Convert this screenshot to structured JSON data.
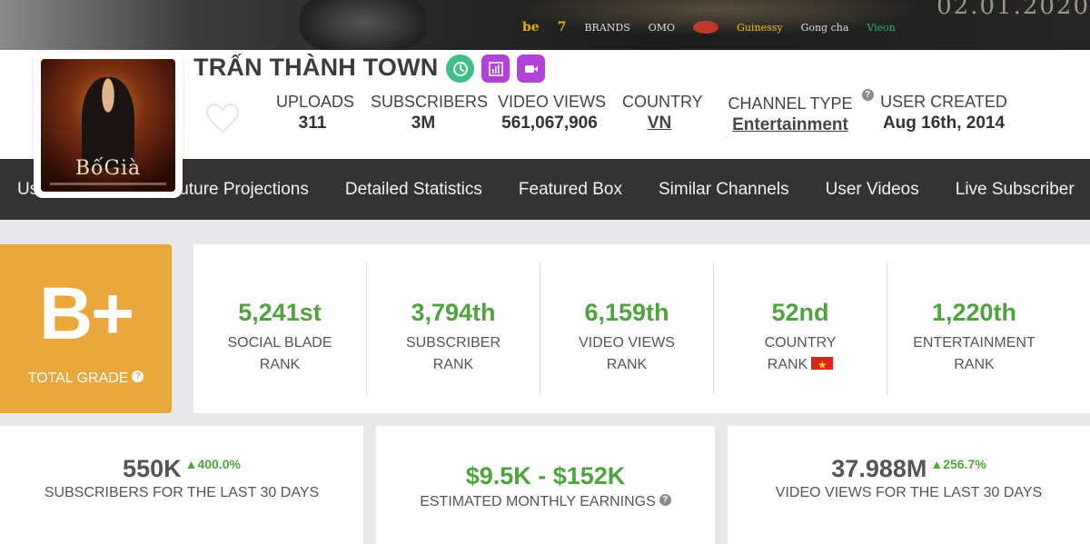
{
  "banner": {
    "sponsors": [
      "be",
      "7",
      "BRANDS",
      "OMO",
      "",
      "Guinessy",
      "Gong cha",
      "Vieon"
    ],
    "date_text": "02.01.2020"
  },
  "channel": {
    "name": "TRẤN THÀNH TOWN",
    "avatar_title": "BốGià"
  },
  "stats": [
    {
      "label": "UPLOADS",
      "value": "311"
    },
    {
      "label": "SUBSCRIBERS",
      "value": "3M"
    },
    {
      "label": "VIDEO VIEWS",
      "value": "561,067,906"
    },
    {
      "label": "COUNTRY",
      "value": "VN"
    },
    {
      "label": "CHANNEL TYPE",
      "value": "Entertainment"
    },
    {
      "label": "USER CREATED",
      "value": "Aug 16th, 2014"
    }
  ],
  "nav": [
    "User Summary",
    "Future Projections",
    "Detailed Statistics",
    "Featured Box",
    "Similar Channels",
    "User Videos",
    "Live Subscriber"
  ],
  "grade": {
    "letter": "B+",
    "label": "TOTAL GRADE",
    "color": "#eaa73b"
  },
  "ranks": [
    {
      "value": "5,241st",
      "line1": "SOCIAL BLADE",
      "line2": "RANK"
    },
    {
      "value": "3,794th",
      "line1": "SUBSCRIBER",
      "line2": "RANK"
    },
    {
      "value": "6,159th",
      "line1": "VIDEO VIEWS",
      "line2": "RANK"
    },
    {
      "value": "52nd",
      "line1": "COUNTRY",
      "line2": "RANK"
    },
    {
      "value": "1,220th",
      "line1": "ENTERTAINMENT",
      "line2": "RANK"
    }
  ],
  "cards": {
    "subs": {
      "value": "550K",
      "delta": "400.0%",
      "caption": "SUBSCRIBERS FOR THE LAST 30 DAYS"
    },
    "earnings": {
      "value": "$9.5K - $152K",
      "caption": "ESTIMATED MONTHLY EARNINGS"
    },
    "views": {
      "value": "37.988M",
      "delta": "256.7%",
      "caption": "VIDEO VIEWS FOR THE LAST 30 DAYS"
    }
  },
  "colors": {
    "accent_green": "#4fa33e",
    "badge_purple": "#b043d6",
    "badge_green": "#3fbf86",
    "nav_bg": "#333333"
  }
}
